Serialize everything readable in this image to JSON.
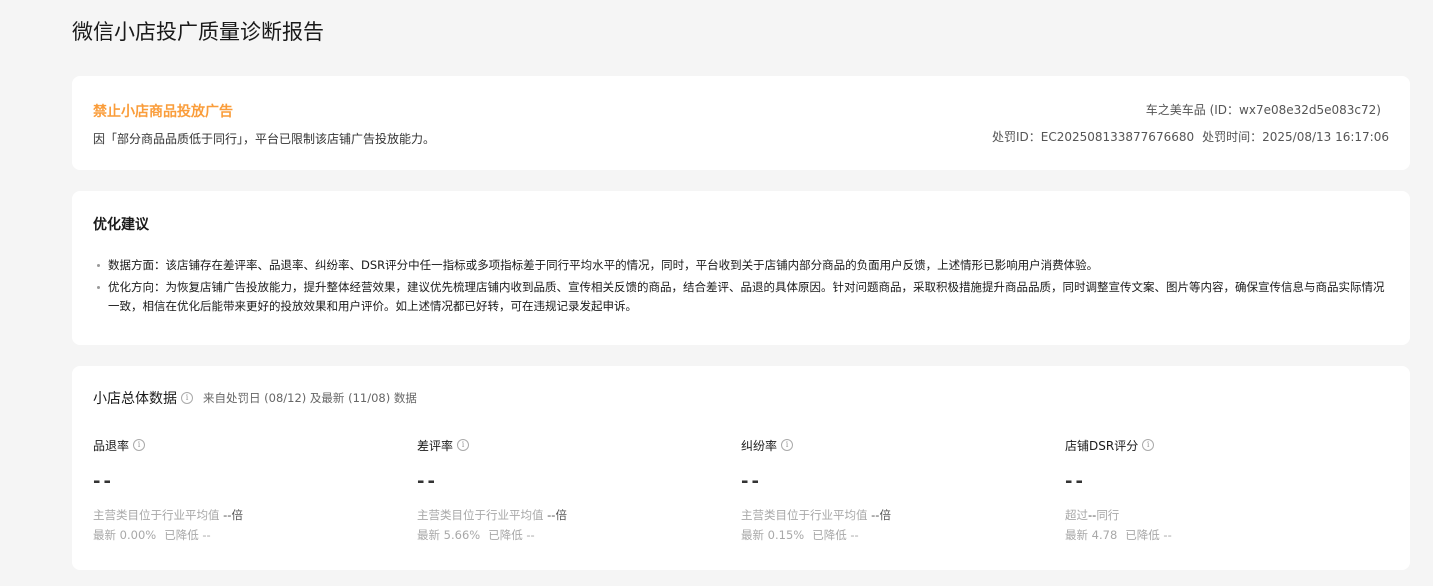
{
  "page": {
    "title": "微信小店投广质量诊断报告"
  },
  "penalty": {
    "title": "禁止小店商品投放广告",
    "description": "因「部分商品品质低于同行」，平台已限制该店铺广告投放能力。",
    "store_label": "车之美车品 (ID：wx7e08e32d5e083c72)",
    "penalty_id_label": "处罚ID：EC202508133877676680",
    "penalty_time_label": "处罚时间：2025/08/13 16:17:06"
  },
  "advice": {
    "title": "优化建议",
    "items": [
      "数据方面：该店铺存在差评率、品退率、纠纷率、DSR评分中任一指标或多项指标差于同行平均水平的情况，同时，平台收到关于店铺内部分商品的负面用户反馈，上述情形已影响用户消费体验。",
      "优化方向：为恢复店铺广告投放能力，提升整体经营效果，建议优先梳理店铺内收到品质、宣传相关反馈的商品，结合差评、品退的具体原因。针对问题商品，采取积极措施提升商品品质，同时调整宣传文案、图片等内容，确保宣传信息与商品实际情况一致，相信在优化后能带来更好的投放效果和用户评价。如上述情况都已好转，可在违规记录发起申诉。"
    ]
  },
  "overview": {
    "title": "小店总体数据",
    "source": "来自处罚日 (08/12) 及最新 (11/08) 数据",
    "metrics": [
      {
        "label": "品退率",
        "value": "--",
        "line1_prefix": "主营类目位于行业平均值",
        "line1_value": "--倍",
        "line2_latest": "最新 0.00%",
        "line2_change": "已降低 --"
      },
      {
        "label": "差评率",
        "value": "--",
        "line1_prefix": "主营类目位于行业平均值",
        "line1_value": "--倍",
        "line2_latest": "最新 5.66%",
        "line2_change": "已降低 --"
      },
      {
        "label": "纠纷率",
        "value": "--",
        "line1_prefix": "主营类目位于行业平均值",
        "line1_value": "--倍",
        "line2_latest": "最新 0.15%",
        "line2_change": "已降低 --"
      },
      {
        "label": "店铺DSR评分",
        "value": "--",
        "line1_prefix": "超过",
        "line1_value": "--",
        "line1_suffix": "同行",
        "line2_latest": "最新 4.78",
        "line2_change": "已降低 --"
      }
    ]
  },
  "icons": {
    "info": "info-icon"
  },
  "colors": {
    "warning": "#fa9d3b",
    "background": "#f5f5f5",
    "card": "#ffffff"
  }
}
